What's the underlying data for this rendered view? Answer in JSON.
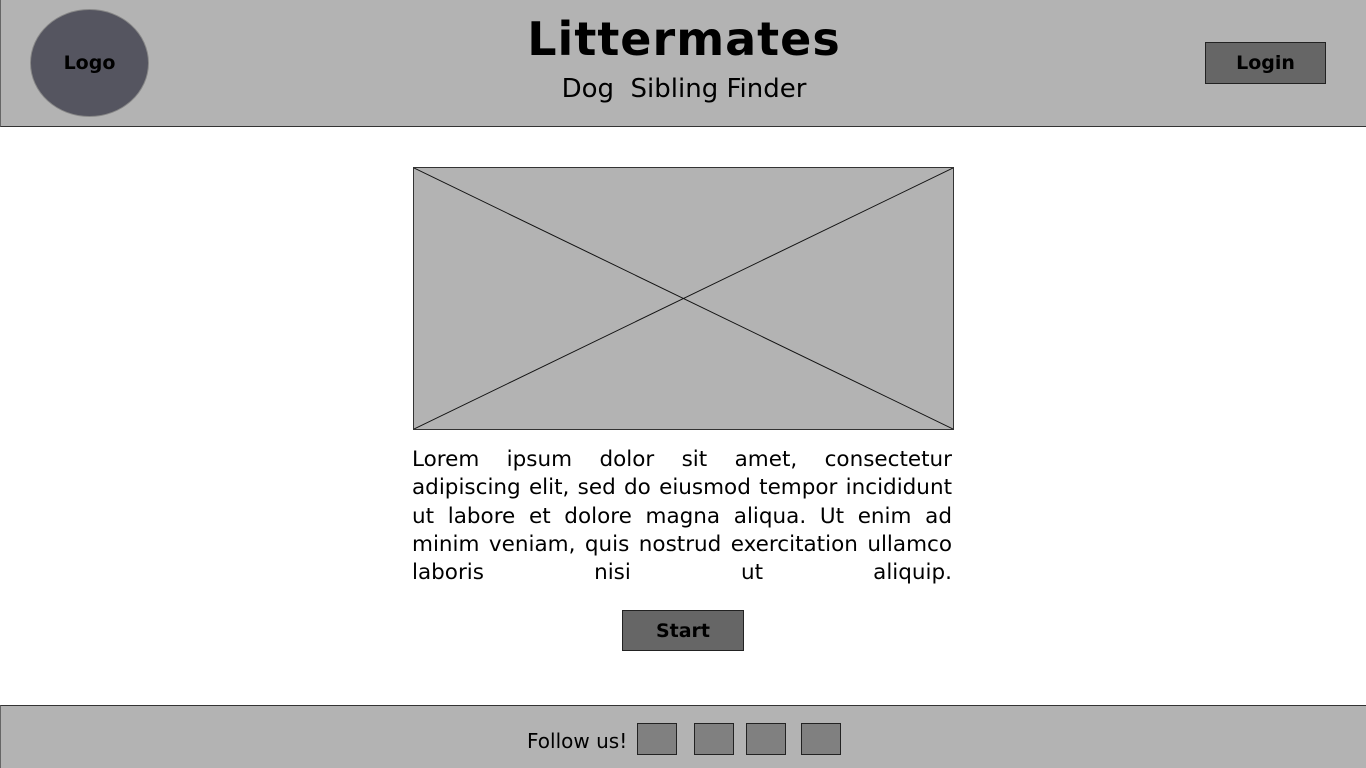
{
  "header": {
    "logo_label": "Logo",
    "title": "Littermates",
    "subtitle": "Dog  Sibling Finder",
    "login_label": "Login"
  },
  "main": {
    "image_placeholder": "image-placeholder",
    "description": "Lorem ipsum dolor sit amet, consectetur adipiscing elit, sed do eiusmod tempor incididunt ut labore et dolore magna aliqua. Ut enim ad minim veniam, quis nostrud exercitation ullamco laboris nisi ut aliquip.",
    "start_label": "Start"
  },
  "footer": {
    "follow_label": "Follow us!",
    "social_links": [
      "social-link-1",
      "social-link-2",
      "social-link-3",
      "social-link-4"
    ]
  },
  "colors": {
    "panel_gray": "#b3b3b3",
    "button_gray": "#666666",
    "logo_fill": "#555560",
    "social_gray": "#808080"
  }
}
